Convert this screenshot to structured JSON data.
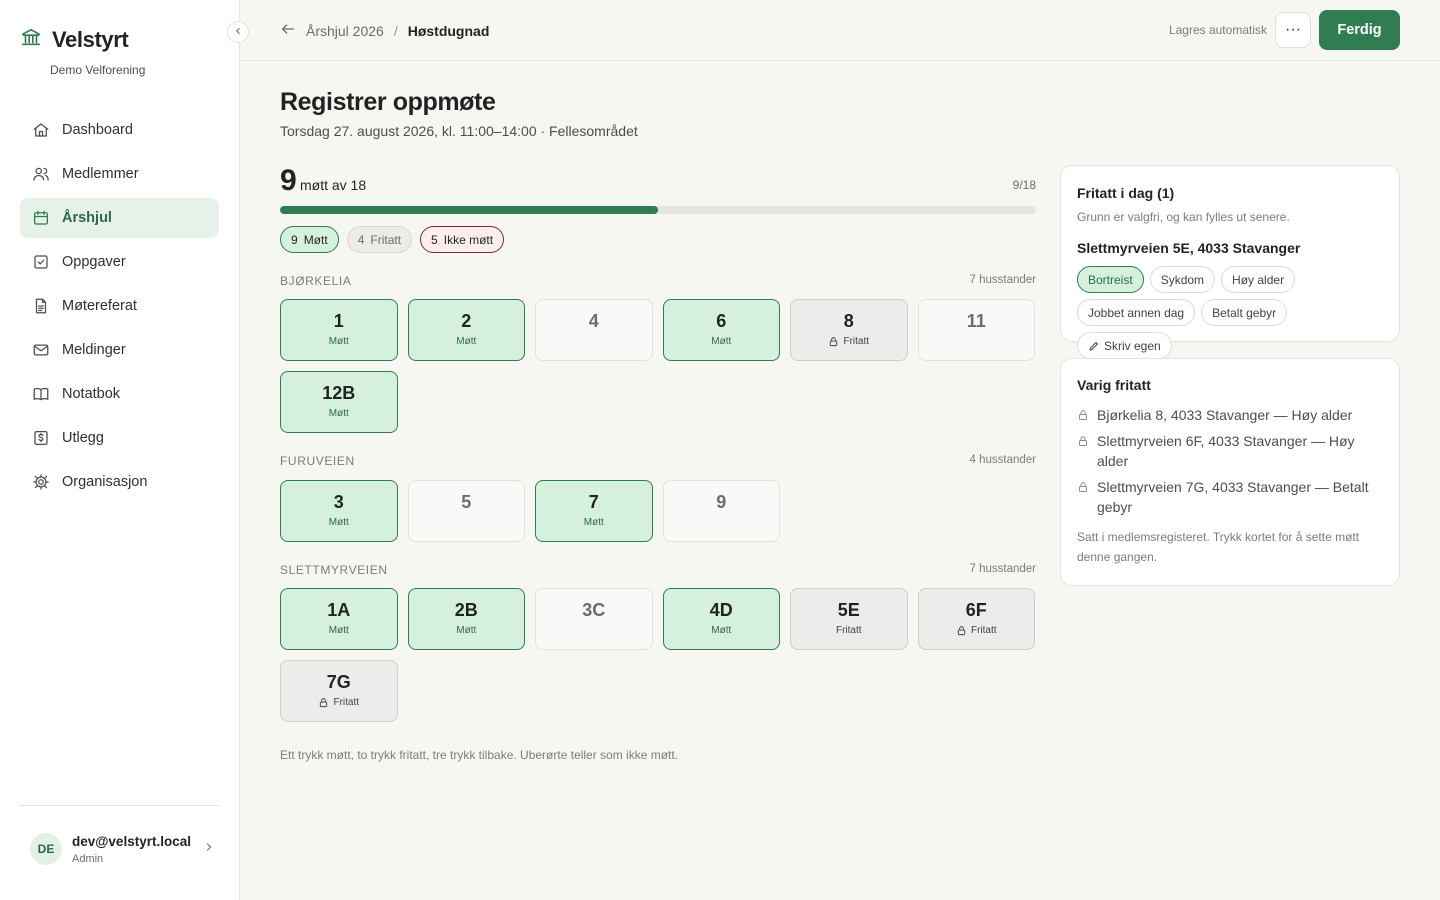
{
  "app": {
    "name": "Velstyrt",
    "org": "Demo Velforening"
  },
  "nav": [
    {
      "label": "Dashboard",
      "icon": "home-icon"
    },
    {
      "label": "Medlemmer",
      "icon": "users-icon"
    },
    {
      "label": "Årshjul",
      "icon": "calendar-icon",
      "active": true
    },
    {
      "label": "Oppgaver",
      "icon": "checkbox-icon"
    },
    {
      "label": "Møtereferat",
      "icon": "document-icon"
    },
    {
      "label": "Meldinger",
      "icon": "mail-icon"
    },
    {
      "label": "Notatbok",
      "icon": "book-icon"
    },
    {
      "label": "Utlegg",
      "icon": "receipt-icon"
    },
    {
      "label": "Organisasjon",
      "icon": "gear-icon"
    }
  ],
  "user": {
    "initials": "DE",
    "email": "dev@velstyrt.local",
    "role": "Admin"
  },
  "topbar": {
    "breadcrumb_parent": "Årshjul 2026",
    "breadcrumb_sep": "/",
    "breadcrumb_current": "Høstdugnad",
    "autosave": "Lagres automatisk",
    "more_label": "···",
    "done_label": "Ferdig"
  },
  "page": {
    "title": "Registrer oppmøte",
    "subtitle": "Torsdag 27. august 2026, kl. 11:00–14:00 · Fellesområdet"
  },
  "progress": {
    "met": "9",
    "met_text": "møtt av 18",
    "ratio": "9/18",
    "fraction": 0.5
  },
  "summary": [
    {
      "count": "9",
      "label": "Møtt",
      "kind": "met"
    },
    {
      "count": "4",
      "label": "Fritatt",
      "kind": "exempt"
    },
    {
      "count": "5",
      "label": "Ikke møtt",
      "kind": "absent"
    }
  ],
  "streets": [
    {
      "name": "BJØRKELIA",
      "count": "7 husstander",
      "houses": [
        {
          "num": "1",
          "status": "met",
          "label": "Møtt"
        },
        {
          "num": "2",
          "status": "met",
          "label": "Møtt"
        },
        {
          "num": "4",
          "status": "none",
          "label": ""
        },
        {
          "num": "6",
          "status": "met",
          "label": "Møtt"
        },
        {
          "num": "8",
          "status": "exempt",
          "label": "Fritatt",
          "locked": true
        },
        {
          "num": "11",
          "status": "none",
          "label": ""
        },
        {
          "num": "12B",
          "status": "met",
          "label": "Møtt"
        }
      ]
    },
    {
      "name": "FURUVEIEN",
      "count": "4 husstander",
      "houses": [
        {
          "num": "3",
          "status": "met",
          "label": "Møtt"
        },
        {
          "num": "5",
          "status": "none",
          "label": ""
        },
        {
          "num": "7",
          "status": "met",
          "label": "Møtt"
        },
        {
          "num": "9",
          "status": "none",
          "label": ""
        }
      ]
    },
    {
      "name": "SLETTMYRVEIEN",
      "count": "7 husstander",
      "houses": [
        {
          "num": "1A",
          "status": "met",
          "label": "Møtt"
        },
        {
          "num": "2B",
          "status": "met",
          "label": "Møtt"
        },
        {
          "num": "3C",
          "status": "none",
          "label": ""
        },
        {
          "num": "4D",
          "status": "met",
          "label": "Møtt"
        },
        {
          "num": "5E",
          "status": "exempt",
          "label": "Fritatt"
        },
        {
          "num": "6F",
          "status": "exempt",
          "label": "Fritatt",
          "locked": true
        },
        {
          "num": "7G",
          "status": "exempt",
          "label": "Fritatt",
          "locked": true
        }
      ]
    }
  ],
  "hint": "Ett trykk møtt, to trykk fritatt, tre trykk tilbake. Uberørte teller som ikke møtt.",
  "exempt_today": {
    "title": "Fritatt i dag (1)",
    "desc": "Grunn er valgfri, og kan fylles ut senere.",
    "address": "Slettmyrveien 5E, 4033 Stavanger",
    "reasons": [
      {
        "label": "Bortreist",
        "selected": true
      },
      {
        "label": "Sykdom"
      },
      {
        "label": "Høy alder"
      },
      {
        "label": "Jobbet annen dag"
      },
      {
        "label": "Betalt gebyr"
      },
      {
        "label": "Skriv egen",
        "icon": "pencil-icon"
      }
    ]
  },
  "permanent": {
    "title": "Varig fritatt",
    "items": [
      "Bjørkelia 8, 4033 Stavanger — Høy alder",
      "Slettmyrveien 6F, 4033 Stavanger — Høy alder",
      "Slettmyrveien 7G, 4033 Stavanger — Betalt gebyr"
    ],
    "note": "Satt i medlemsregisteret. Trykk kortet for å sette møtt denne gangen."
  },
  "colors": {
    "accent": "#2f7d50",
    "met_bg": "#d5f1de",
    "exempt_bg": "#ececea",
    "absent_border": "#7a2a2a"
  }
}
